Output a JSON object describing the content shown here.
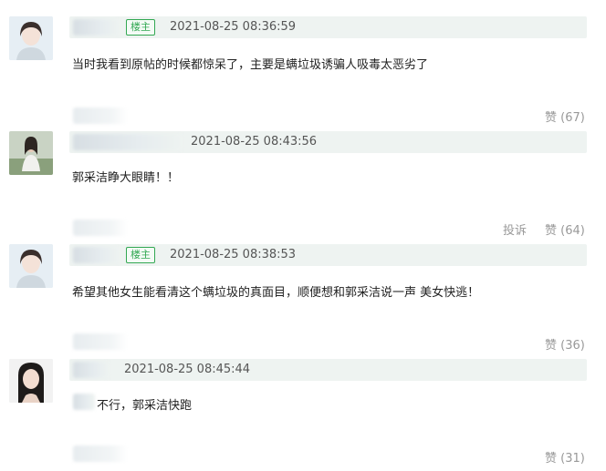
{
  "comments": [
    {
      "badge": "楼主",
      "timestamp": "2021-08-25 08:36:59",
      "content": "当时我看到原帖的时候都惊呆了，主要是螨垃圾诱骗人吸毒太恶劣了",
      "likes": "赞 (67)"
    },
    {
      "timestamp": "2021-08-25 08:43:56",
      "content": "郭采洁睁大眼睛！！",
      "report": "投诉",
      "likes": "赞 (64)"
    },
    {
      "badge": "楼主",
      "timestamp": "2021-08-25 08:38:53",
      "content": "希望其他女生能看清这个螨垃圾的真面目，顺便想和郭采洁说一声 美女快逃！",
      "likes": "赞 (36)"
    },
    {
      "timestamp": "2021-08-25 08:45:44",
      "content": "不行，郭采洁快跑",
      "likes": "赞 (31)"
    }
  ],
  "colors": {
    "header_bg": "#eef3f1",
    "badge_green": "#33a853",
    "muted": "#999999"
  },
  "icons": [
    "avatar-woman",
    "avatar-outdoor",
    "avatar-woman",
    "avatar-portrait"
  ]
}
